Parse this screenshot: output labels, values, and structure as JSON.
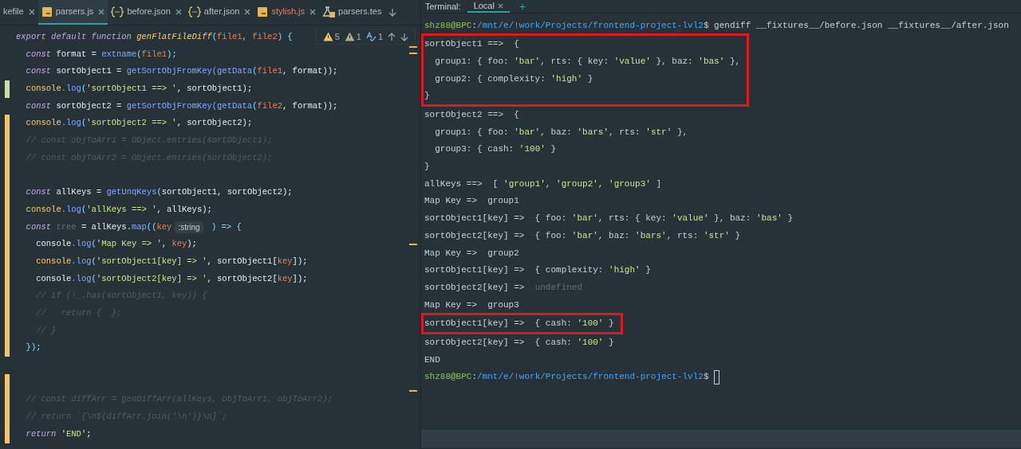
{
  "editor": {
    "tabs": [
      {
        "label": "kefile",
        "kind": "plain",
        "selected": false,
        "error": false
      },
      {
        "label": "parsers.js",
        "kind": "js",
        "selected": true,
        "error": false
      },
      {
        "label": "before.json",
        "kind": "json",
        "selected": false,
        "error": false
      },
      {
        "label": "after.json",
        "kind": "json",
        "selected": false,
        "error": false
      },
      {
        "label": "stylish.js",
        "kind": "js",
        "selected": false,
        "error": true
      },
      {
        "label": "parsers.tes",
        "kind": "test",
        "selected": false,
        "error": false
      }
    ],
    "inspections": [
      {
        "kind": "warning",
        "count": "5"
      },
      {
        "kind": "weak",
        "count": "1"
      },
      {
        "kind": "typo",
        "count": "1"
      }
    ],
    "lines": [
      {
        "added": false,
        "modified": false,
        "tokens": [
          {
            "kind": "kw",
            "t": "export default function "
          },
          {
            "kind": "fnname",
            "t": "genFlatFileDiff"
          },
          {
            "kind": "pu",
            "t": "("
          },
          {
            "kind": "par",
            "t": "file1"
          },
          {
            "kind": "pu",
            "t": ", "
          },
          {
            "kind": "par",
            "t": "file2"
          },
          {
            "kind": "pu",
            "t": ") {"
          }
        ]
      },
      {
        "added": false,
        "modified": false,
        "tokens": [
          {
            "kind": "kw",
            "t": "  const "
          },
          {
            "kind": "id",
            "t": "format = "
          },
          {
            "kind": "fn",
            "t": "extname"
          },
          {
            "kind": "pu",
            "t": "("
          },
          {
            "kind": "par",
            "t": "file1"
          },
          {
            "kind": "pu",
            "t": ");"
          }
        ]
      },
      {
        "added": false,
        "modified": false,
        "tokens": [
          {
            "kind": "kw",
            "t": "  const "
          },
          {
            "kind": "id",
            "t": "sortObject1 = "
          },
          {
            "kind": "fn",
            "t": "getSortObjFromKey(getData"
          },
          {
            "kind": "pu",
            "t": "("
          },
          {
            "kind": "par",
            "t": "file1"
          },
          {
            "kind": "id",
            "t": ", format));"
          }
        ]
      },
      {
        "added": true,
        "modified": false,
        "tokens": [
          {
            "kind": "obj",
            "t": "  console"
          },
          {
            "kind": "fn",
            "t": ".log"
          },
          {
            "kind": "pu",
            "t": "("
          },
          {
            "kind": "str",
            "t": "'sortObject1 ==> '"
          },
          {
            "kind": "id",
            "t": ", sortObject1);"
          }
        ]
      },
      {
        "added": false,
        "modified": false,
        "tokens": [
          {
            "kind": "kw",
            "t": "  const "
          },
          {
            "kind": "id",
            "t": "sortObject2 = "
          },
          {
            "kind": "fn",
            "t": "getSortObjFromKey(getData"
          },
          {
            "kind": "pu",
            "t": "("
          },
          {
            "kind": "par",
            "t": "file2"
          },
          {
            "kind": "id",
            "t": ", format));"
          }
        ]
      },
      {
        "added": false,
        "modified": true,
        "tokens": [
          {
            "kind": "obj",
            "t": "  console"
          },
          {
            "kind": "fn",
            "t": ".log"
          },
          {
            "kind": "pu",
            "t": "("
          },
          {
            "kind": "str",
            "t": "'sortObject2 ==> '"
          },
          {
            "kind": "id",
            "t": ", sortObject2);"
          }
        ]
      },
      {
        "added": false,
        "modified": true,
        "tokens": [
          {
            "kind": "cm",
            "t": "  // const objToArr1 = Object.entries(sortObject1);"
          }
        ]
      },
      {
        "added": false,
        "modified": true,
        "tokens": [
          {
            "kind": "cm",
            "t": "  // const objToArr2 = Object.entries(sortObject2);"
          }
        ]
      },
      {
        "added": false,
        "modified": true
      },
      {
        "added": false,
        "modified": true,
        "tokens": [
          {
            "kind": "kw",
            "t": "  const "
          },
          {
            "kind": "id",
            "t": "allKeys = "
          },
          {
            "kind": "fn",
            "t": "getUnqKeys"
          },
          {
            "kind": "pu",
            "t": "("
          },
          {
            "kind": "id",
            "t": "sortObject1, sortObject2);"
          }
        ]
      },
      {
        "added": false,
        "modified": true,
        "tokens": [
          {
            "kind": "obj",
            "t": "  console"
          },
          {
            "kind": "fn",
            "t": ".log"
          },
          {
            "kind": "pu",
            "t": "("
          },
          {
            "kind": "str",
            "t": "'allKeys ==> '"
          },
          {
            "kind": "id",
            "t": ", allKeys);"
          }
        ]
      },
      {
        "added": false,
        "modified": true,
        "tokens": [
          {
            "kind": "kw",
            "t": "  const "
          },
          {
            "kind": "dim",
            "t": "tree"
          },
          {
            "kind": "id",
            "t": " = allKeys."
          },
          {
            "kind": "fn",
            "t": "map"
          },
          {
            "kind": "pu",
            "t": "(("
          },
          {
            "kind": "par",
            "t": "key"
          },
          {
            "kind": "hint",
            "t": ":string"
          },
          {
            "kind": "pu",
            "t": " ) => {"
          }
        ]
      },
      {
        "added": false,
        "modified": true,
        "tokens": [
          {
            "kind": "id",
            "t": "    console"
          },
          {
            "kind": "fn",
            "t": ".log"
          },
          {
            "kind": "pu",
            "t": "("
          },
          {
            "kind": "str",
            "t": "'Map Key => '"
          },
          {
            "kind": "id",
            "t": ", "
          },
          {
            "kind": "par",
            "t": "key"
          },
          {
            "kind": "id",
            "t": ");"
          }
        ]
      },
      {
        "added": false,
        "modified": true,
        "tokens": [
          {
            "kind": "obj",
            "t": "    console"
          },
          {
            "kind": "fn",
            "t": ".log"
          },
          {
            "kind": "pu",
            "t": "("
          },
          {
            "kind": "str",
            "t": "'sortObject1[key] => '"
          },
          {
            "kind": "id",
            "t": ", sortObject1["
          },
          {
            "kind": "par",
            "t": "key"
          },
          {
            "kind": "id",
            "t": "]);"
          }
        ]
      },
      {
        "added": false,
        "modified": true,
        "tokens": [
          {
            "kind": "id",
            "t": "    console"
          },
          {
            "kind": "fn",
            "t": ".log"
          },
          {
            "kind": "pu",
            "t": "("
          },
          {
            "kind": "str",
            "t": "'sortObject2[key] => '"
          },
          {
            "kind": "id",
            "t": ", sortObject2["
          },
          {
            "kind": "par",
            "t": "key"
          },
          {
            "kind": "id",
            "t": "]);"
          }
        ]
      },
      {
        "added": false,
        "modified": true,
        "tokens": [
          {
            "kind": "cm",
            "t": "    // if (!_.has(sortObject1, key)) {"
          }
        ]
      },
      {
        "added": false,
        "modified": true,
        "tokens": [
          {
            "kind": "cm",
            "t": "    //   return {  };"
          }
        ]
      },
      {
        "added": false,
        "modified": true,
        "tokens": [
          {
            "kind": "cm",
            "t": "    // }"
          }
        ]
      },
      {
        "added": false,
        "modified": true,
        "tokens": [
          {
            "kind": "pu",
            "t": "  });"
          }
        ]
      },
      {
        "added": false,
        "modified": false
      },
      {
        "added": false,
        "modified": true
      },
      {
        "added": false,
        "modified": true,
        "tokens": [
          {
            "kind": "cm",
            "t": "  // const diffArr = genDiffArr(allKeys, objToArr1, objToArr2);"
          }
        ]
      },
      {
        "added": false,
        "modified": true,
        "tokens": [
          {
            "kind": "cm",
            "t": "  // return `{\\n${diffArr.join('\\n')}\\n}`;"
          }
        ]
      },
      {
        "added": false,
        "modified": true,
        "tokens": [
          {
            "kind": "kw",
            "t": "  return "
          },
          {
            "kind": "str",
            "t": "'END'"
          },
          {
            "kind": "id",
            "t": ";"
          }
        ]
      }
    ]
  },
  "terminal": {
    "label": "Terminal:",
    "tabs": [
      {
        "label": "Local",
        "selected": true
      }
    ],
    "add": "+",
    "groups": [
      {
        "boxed": false,
        "lines": [
          {
            "cursor": false,
            "tokens": [
              {
                "kind": "user",
                "t": "shz88@BPC"
              },
              {
                "kind": "plain",
                "t": ":"
              },
              {
                "kind": "path",
                "t": "/mnt/e/!work/Projects/frontend-project-lvl2"
              },
              {
                "kind": "plain",
                "t": "$ gendiff __fixtures__/before.json __fixtures__/after.json"
              }
            ]
          }
        ]
      },
      {
        "boxed": true,
        "lines": [
          {
            "cursor": false,
            "tokens": [
              {
                "kind": "plain",
                "t": "sortObject1 ==>  {"
              }
            ]
          },
          {
            "cursor": false,
            "tokens": [
              {
                "kind": "plain",
                "t": "  group1: { foo: "
              },
              {
                "kind": "str",
                "t": "'bar'"
              },
              {
                "kind": "plain",
                "t": ", rts: { key: "
              },
              {
                "kind": "str",
                "t": "'value'"
              },
              {
                "kind": "plain",
                "t": " }, baz: "
              },
              {
                "kind": "str",
                "t": "'bas'"
              },
              {
                "kind": "plain",
                "t": " },"
              }
            ]
          },
          {
            "cursor": false,
            "tokens": [
              {
                "kind": "plain",
                "t": "  group2: { complexity: "
              },
              {
                "kind": "str",
                "t": "'high'"
              },
              {
                "kind": "plain",
                "t": " }"
              }
            ]
          },
          {
            "cursor": false,
            "tokens": [
              {
                "kind": "plain",
                "t": "}"
              }
            ]
          }
        ]
      },
      {
        "boxed": false,
        "lines": [
          {
            "cursor": false,
            "tokens": [
              {
                "kind": "plain",
                "t": "sortObject2 ==>  {"
              }
            ]
          },
          {
            "cursor": false,
            "tokens": [
              {
                "kind": "plain",
                "t": "  group1: { foo: "
              },
              {
                "kind": "str",
                "t": "'bar'"
              },
              {
                "kind": "plain",
                "t": ", baz: "
              },
              {
                "kind": "str",
                "t": "'bars'"
              },
              {
                "kind": "plain",
                "t": ", rts: "
              },
              {
                "kind": "str",
                "t": "'str'"
              },
              {
                "kind": "plain",
                "t": " },"
              }
            ]
          },
          {
            "cursor": false,
            "tokens": [
              {
                "kind": "plain",
                "t": "  group3: { cash: "
              },
              {
                "kind": "str",
                "t": "'100'"
              },
              {
                "kind": "plain",
                "t": " }"
              }
            ]
          },
          {
            "cursor": false,
            "tokens": [
              {
                "kind": "plain",
                "t": "}"
              }
            ]
          },
          {
            "cursor": false,
            "tokens": [
              {
                "kind": "plain",
                "t": "allKeys ==>  [ "
              },
              {
                "kind": "str",
                "t": "'group1'"
              },
              {
                "kind": "plain",
                "t": ", "
              },
              {
                "kind": "str",
                "t": "'group2'"
              },
              {
                "kind": "plain",
                "t": ", "
              },
              {
                "kind": "str",
                "t": "'group3'"
              },
              {
                "kind": "plain",
                "t": " ]"
              }
            ]
          },
          {
            "cursor": false,
            "tokens": [
              {
                "kind": "plain",
                "t": "Map Key =>  group1"
              }
            ]
          },
          {
            "cursor": false,
            "tokens": [
              {
                "kind": "plain",
                "t": "sortObject1[key] =>  { foo: "
              },
              {
                "kind": "str",
                "t": "'bar'"
              },
              {
                "kind": "plain",
                "t": ", rts: { key: "
              },
              {
                "kind": "str",
                "t": "'value'"
              },
              {
                "kind": "plain",
                "t": " }, baz: "
              },
              {
                "kind": "str",
                "t": "'bas'"
              },
              {
                "kind": "plain",
                "t": " }"
              }
            ]
          },
          {
            "cursor": false,
            "tokens": [
              {
                "kind": "plain",
                "t": "sortObject2[key] =>  { foo: "
              },
              {
                "kind": "str",
                "t": "'bar'"
              },
              {
                "kind": "plain",
                "t": ", baz: "
              },
              {
                "kind": "str",
                "t": "'bars'"
              },
              {
                "kind": "plain",
                "t": ", rts: "
              },
              {
                "kind": "str",
                "t": "'str'"
              },
              {
                "kind": "plain",
                "t": " }"
              }
            ]
          },
          {
            "cursor": false,
            "tokens": [
              {
                "kind": "plain",
                "t": "Map Key =>  group2"
              }
            ]
          },
          {
            "cursor": false,
            "tokens": [
              {
                "kind": "plain",
                "t": "sortObject1[key] =>  { complexity: "
              },
              {
                "kind": "str",
                "t": "'high'"
              },
              {
                "kind": "plain",
                "t": " }"
              }
            ]
          },
          {
            "cursor": false,
            "tokens": [
              {
                "kind": "plain",
                "t": "sortObject2[key] =>  "
              },
              {
                "kind": "dim",
                "t": "undefined"
              }
            ]
          },
          {
            "cursor": false,
            "tokens": [
              {
                "kind": "plain",
                "t": "Map Key =>  group3"
              }
            ]
          }
        ]
      },
      {
        "boxed": true,
        "lines": [
          {
            "cursor": false,
            "tokens": [
              {
                "kind": "plain",
                "t": "sortObject1[key] =>  { cash: "
              },
              {
                "kind": "str",
                "t": "'100'"
              },
              {
                "kind": "plain",
                "t": " }"
              }
            ]
          }
        ]
      },
      {
        "boxed": false,
        "lines": [
          {
            "cursor": false,
            "tokens": [
              {
                "kind": "plain",
                "t": "sortObject2[key] =>  { cash: "
              },
              {
                "kind": "str",
                "t": "'100'"
              },
              {
                "kind": "plain",
                "t": " }"
              }
            ]
          },
          {
            "cursor": false,
            "tokens": [
              {
                "kind": "plain",
                "t": "END"
              }
            ]
          },
          {
            "cursor": true,
            "tokens": [
              {
                "kind": "user",
                "t": "shz88@BPC"
              },
              {
                "kind": "plain",
                "t": ":"
              },
              {
                "kind": "path",
                "t": "/mnt/e/!work/Projects/frontend-project-lvl2"
              },
              {
                "kind": "plain",
                "t": "$ "
              }
            ]
          }
        ]
      }
    ]
  }
}
